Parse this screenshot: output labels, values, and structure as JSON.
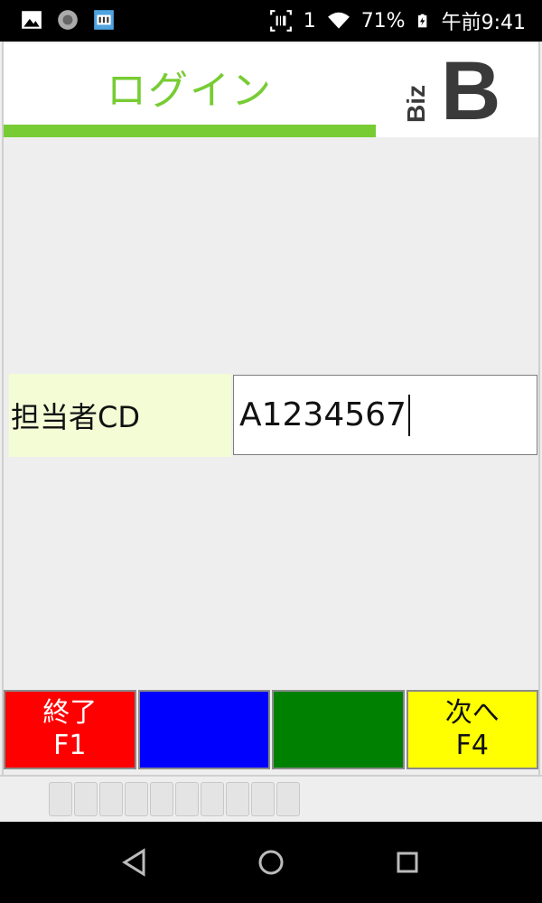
{
  "status_bar": {
    "battery_text": "71%",
    "time": "午前9:41",
    "signal_label": "1"
  },
  "header": {
    "title": "ログイン",
    "title_color": "#77cc33",
    "logo": {
      "vertical_text": "Biz",
      "big_letter": "B"
    }
  },
  "form": {
    "field_label": "担当者CD",
    "field_value": "A1234567"
  },
  "function_keys": [
    {
      "line1": "終了",
      "line2": "F1",
      "color": "#ff0000"
    },
    {
      "line1": "",
      "line2": "",
      "color": "#0000ff"
    },
    {
      "line1": "",
      "line2": "",
      "color": "#008000"
    },
    {
      "line1": "次へ",
      "line2": "F4",
      "color": "#ffff00"
    }
  ]
}
